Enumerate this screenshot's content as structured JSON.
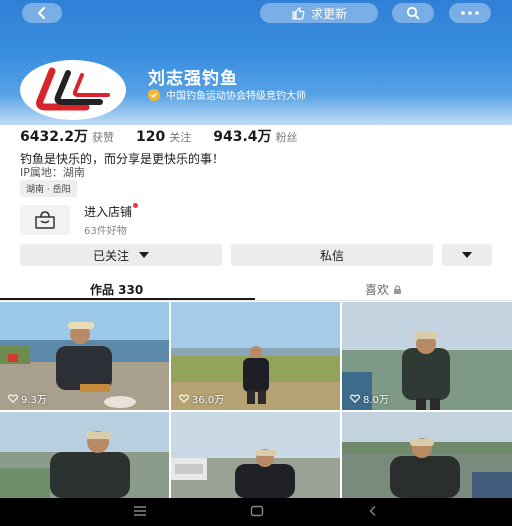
{
  "topbar": {
    "update_label": "求更新"
  },
  "profile": {
    "name": "刘志强钓鱼",
    "verification": "中国钓鱼运动协会特级竞钓大师"
  },
  "stats": {
    "likes_count": "6432.2万",
    "likes_label": "获赞",
    "following_count": "120",
    "following_label": "关注",
    "followers_count": "943.4万",
    "followers_label": "粉丝"
  },
  "bio": {
    "text": "钓鱼是快乐的，而分享是更快乐的事！",
    "ip": "IP属地：湖南",
    "location_tag": "湖南 · 岳阳"
  },
  "shop": {
    "title": "进入店铺",
    "subtitle": "63件好物"
  },
  "actions": {
    "followed_label": "已关注",
    "message_label": "私信"
  },
  "tabs": {
    "works_label": "作品 330",
    "likes_label": "喜欢"
  },
  "videos": [
    {
      "likes": "9.3万"
    },
    {
      "likes": "36.0万"
    },
    {
      "likes": "8.0万"
    },
    {
      "likes": ""
    },
    {
      "likes": ""
    },
    {
      "likes": ""
    }
  ],
  "colors": {
    "banner": "#3a8fe0",
    "verify_badge": "#f5b82e",
    "notification_dot": "#f2354d"
  }
}
